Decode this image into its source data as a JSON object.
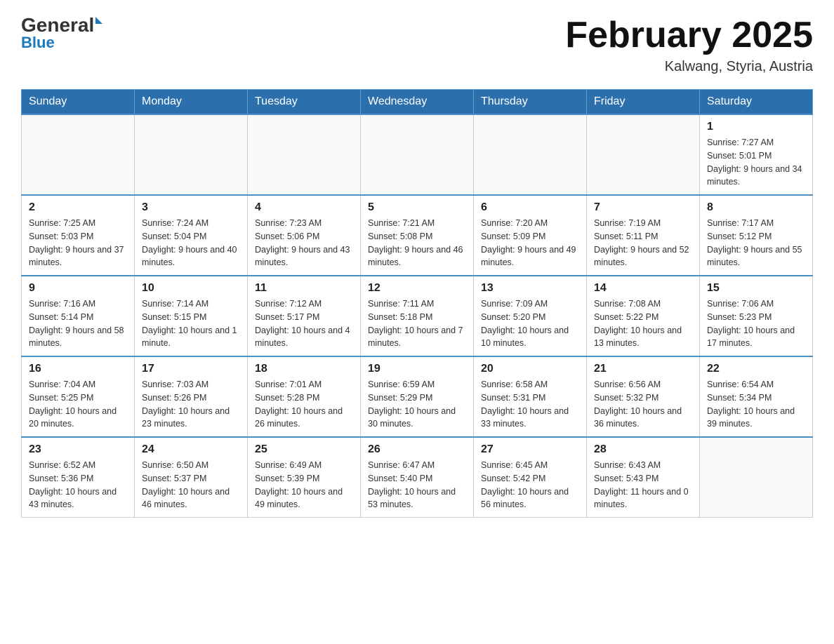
{
  "header": {
    "logo_main": "General",
    "logo_sub": "Blue",
    "month_title": "February 2025",
    "location": "Kalwang, Styria, Austria"
  },
  "weekdays": [
    "Sunday",
    "Monday",
    "Tuesday",
    "Wednesday",
    "Thursday",
    "Friday",
    "Saturday"
  ],
  "weeks": [
    [
      {
        "day": "",
        "info": ""
      },
      {
        "day": "",
        "info": ""
      },
      {
        "day": "",
        "info": ""
      },
      {
        "day": "",
        "info": ""
      },
      {
        "day": "",
        "info": ""
      },
      {
        "day": "",
        "info": ""
      },
      {
        "day": "1",
        "info": "Sunrise: 7:27 AM\nSunset: 5:01 PM\nDaylight: 9 hours and 34 minutes."
      }
    ],
    [
      {
        "day": "2",
        "info": "Sunrise: 7:25 AM\nSunset: 5:03 PM\nDaylight: 9 hours and 37 minutes."
      },
      {
        "day": "3",
        "info": "Sunrise: 7:24 AM\nSunset: 5:04 PM\nDaylight: 9 hours and 40 minutes."
      },
      {
        "day": "4",
        "info": "Sunrise: 7:23 AM\nSunset: 5:06 PM\nDaylight: 9 hours and 43 minutes."
      },
      {
        "day": "5",
        "info": "Sunrise: 7:21 AM\nSunset: 5:08 PM\nDaylight: 9 hours and 46 minutes."
      },
      {
        "day": "6",
        "info": "Sunrise: 7:20 AM\nSunset: 5:09 PM\nDaylight: 9 hours and 49 minutes."
      },
      {
        "day": "7",
        "info": "Sunrise: 7:19 AM\nSunset: 5:11 PM\nDaylight: 9 hours and 52 minutes."
      },
      {
        "day": "8",
        "info": "Sunrise: 7:17 AM\nSunset: 5:12 PM\nDaylight: 9 hours and 55 minutes."
      }
    ],
    [
      {
        "day": "9",
        "info": "Sunrise: 7:16 AM\nSunset: 5:14 PM\nDaylight: 9 hours and 58 minutes."
      },
      {
        "day": "10",
        "info": "Sunrise: 7:14 AM\nSunset: 5:15 PM\nDaylight: 10 hours and 1 minute."
      },
      {
        "day": "11",
        "info": "Sunrise: 7:12 AM\nSunset: 5:17 PM\nDaylight: 10 hours and 4 minutes."
      },
      {
        "day": "12",
        "info": "Sunrise: 7:11 AM\nSunset: 5:18 PM\nDaylight: 10 hours and 7 minutes."
      },
      {
        "day": "13",
        "info": "Sunrise: 7:09 AM\nSunset: 5:20 PM\nDaylight: 10 hours and 10 minutes."
      },
      {
        "day": "14",
        "info": "Sunrise: 7:08 AM\nSunset: 5:22 PM\nDaylight: 10 hours and 13 minutes."
      },
      {
        "day": "15",
        "info": "Sunrise: 7:06 AM\nSunset: 5:23 PM\nDaylight: 10 hours and 17 minutes."
      }
    ],
    [
      {
        "day": "16",
        "info": "Sunrise: 7:04 AM\nSunset: 5:25 PM\nDaylight: 10 hours and 20 minutes."
      },
      {
        "day": "17",
        "info": "Sunrise: 7:03 AM\nSunset: 5:26 PM\nDaylight: 10 hours and 23 minutes."
      },
      {
        "day": "18",
        "info": "Sunrise: 7:01 AM\nSunset: 5:28 PM\nDaylight: 10 hours and 26 minutes."
      },
      {
        "day": "19",
        "info": "Sunrise: 6:59 AM\nSunset: 5:29 PM\nDaylight: 10 hours and 30 minutes."
      },
      {
        "day": "20",
        "info": "Sunrise: 6:58 AM\nSunset: 5:31 PM\nDaylight: 10 hours and 33 minutes."
      },
      {
        "day": "21",
        "info": "Sunrise: 6:56 AM\nSunset: 5:32 PM\nDaylight: 10 hours and 36 minutes."
      },
      {
        "day": "22",
        "info": "Sunrise: 6:54 AM\nSunset: 5:34 PM\nDaylight: 10 hours and 39 minutes."
      }
    ],
    [
      {
        "day": "23",
        "info": "Sunrise: 6:52 AM\nSunset: 5:36 PM\nDaylight: 10 hours and 43 minutes."
      },
      {
        "day": "24",
        "info": "Sunrise: 6:50 AM\nSunset: 5:37 PM\nDaylight: 10 hours and 46 minutes."
      },
      {
        "day": "25",
        "info": "Sunrise: 6:49 AM\nSunset: 5:39 PM\nDaylight: 10 hours and 49 minutes."
      },
      {
        "day": "26",
        "info": "Sunrise: 6:47 AM\nSunset: 5:40 PM\nDaylight: 10 hours and 53 minutes."
      },
      {
        "day": "27",
        "info": "Sunrise: 6:45 AM\nSunset: 5:42 PM\nDaylight: 10 hours and 56 minutes."
      },
      {
        "day": "28",
        "info": "Sunrise: 6:43 AM\nSunset: 5:43 PM\nDaylight: 11 hours and 0 minutes."
      },
      {
        "day": "",
        "info": ""
      }
    ]
  ]
}
